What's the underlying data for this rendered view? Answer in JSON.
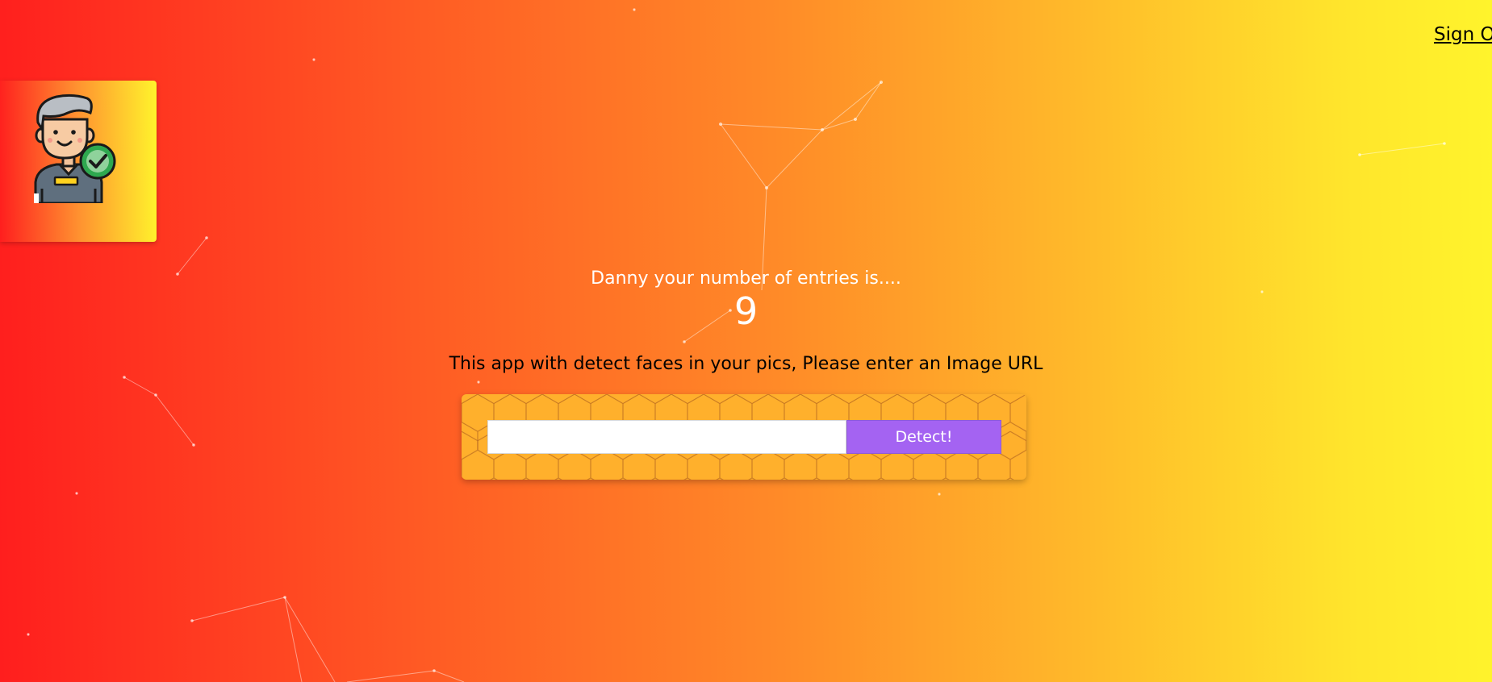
{
  "nav": {
    "sign_out_label": "Sign Out"
  },
  "logo": {
    "icon": "user-verified-avatar-icon"
  },
  "rank": {
    "message": "Danny your number of entries is....",
    "entries": "9"
  },
  "intro": {
    "text": "This app with detect faces in your pics, Please enter an Image URL"
  },
  "image_form": {
    "url_value": "",
    "url_placeholder": "",
    "detect_label": "Detect!"
  },
  "colors": {
    "gradient_start": "#ff1e1e",
    "gradient_end": "#fff42c",
    "detect_button": "#a463f2",
    "form_background": "#ffb02c"
  }
}
